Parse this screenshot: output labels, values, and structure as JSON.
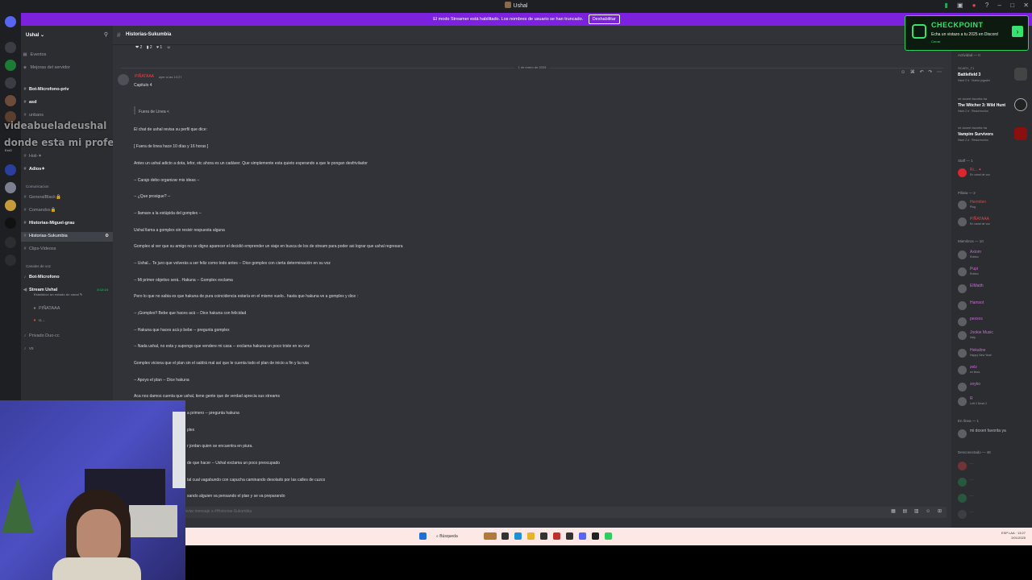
{
  "window": {
    "title": "Ushal"
  },
  "streamer_bar": {
    "text": "El modo Streamer está habilitado. Los nombres de usuario se han truncado.",
    "button": "Deshabilitar"
  },
  "sidebar": {
    "server_name": "Ushal",
    "items": [
      {
        "type": "link",
        "label": "Eventos",
        "icon": "calendar-icon"
      },
      {
        "type": "link",
        "label": "Mejoras del servidor",
        "icon": "boost-icon"
      },
      {
        "type": "channel",
        "label": "Bot-Microfono-priv",
        "bold": true
      },
      {
        "type": "channel",
        "label": "asd",
        "bold": true
      },
      {
        "type": "channel",
        "label": "unbans"
      },
      {
        "type": "channel",
        "label": "Holi-✦"
      },
      {
        "type": "channel",
        "label": "Adios✦",
        "bold": true
      },
      {
        "type": "category",
        "label": "Comunicacion"
      },
      {
        "type": "channel",
        "label": "GeneralBlack🔒"
      },
      {
        "type": "channel",
        "label": "Comandos🔒"
      },
      {
        "type": "channel",
        "label": "Historias-Miguel-grau",
        "bold": true
      },
      {
        "type": "channel",
        "label": "Historias-Sukumbia",
        "active": true
      },
      {
        "type": "channel",
        "label": "Clips-Videoss"
      },
      {
        "type": "category",
        "label": "Canales de voz"
      },
      {
        "type": "channel",
        "label": "Bot-Microfono",
        "bold": true
      },
      {
        "type": "voice",
        "label": "Stream Ushal",
        "bold": true,
        "live": "3:12:24",
        "sub": "Establece un estado de canal ✎"
      },
      {
        "type": "user",
        "label": "PIÑATAAA"
      },
      {
        "type": "user",
        "label": "u..."
      },
      {
        "type": "channel",
        "label": "Privado Duo-cc"
      },
      {
        "type": "channel",
        "label": "vs"
      }
    ],
    "overlay_line1": "videabueladeushal",
    "overlay_line2": "donde esta mi profe.hakuna",
    "rail_label": "EstG"
  },
  "channel_header": {
    "name": "Historias-Sukumbia"
  },
  "reactions": [
    "❤ 2",
    "▮ 2",
    "♥ 1",
    "☺"
  ],
  "date_divider": "1 de enero de 2025",
  "message": {
    "author": "PIÑATAAA",
    "time": "ayer a las 13:27",
    "lines": [
      "Capitulo 4",
      "Fuera de Linea <",
      "El chat de ushal revisa su perfil que dice:",
      "[ Fuera de linea hace 10 días y 16 horas ]",
      "Antes un ushal adicto a dota, lefor, etc ahora es un cadáver. Que simplemente esta quieto esperando a que le pongan desfrivilador",
      "-- Carajo debo organizar mis ideas --",
      "-- ¿Que prosigue? --",
      "-- llamare a la estúpida del gomplex --",
      "Ushal llama a gomplex sin resivir respuesta alguna",
      "Gomplex al ver que su amigo no se digno aparecer el decidió emprender un viaje en busca de los de stream para poder asi lograr que ushal regresara",
      "-- Ushal... Te juro que volverás a ser feliz como todo antes --   Dice gomplex con cierta determinación en su voz",
      "-- Mi primer objetivo será.. Hakuna -- Gomplex exclama",
      "Pero lo que no sabia es que hakuna de pura coincidencia estaría en el mismo vuelo.. hasta que hakuna ve a gomplex y dice :",
      "-- ¡Gomplex!! Bebe que haces acá -- Dice hakuna con felicidad",
      "-- Hakuna que haces acá p bebe -- pregunta gomplex",
      "-- Nada ushal, no esta y supongo que vendere mi casa -- exclama hakuna un poco triste en su voz",
      "Gomplex viciona que el plan sin el saldrá mal así que le cuenta todo el plan de inicio a fin y la ruta",
      "-- Apoyo el plan -- Dice hakuna",
      "Aca nos damos cuenta que ushal, tiene gente que de verdad aprecia sus streams",
      "a primero -- pregunta hakuna",
      "plex",
      "r jordan quien se encuentra en piura.",
      "de que hacer -- Ushal exclama un poco preocupado",
      "tal cual vagabundo con capucha caminando desolado por las calles de cuzco",
      "sando alguien va pensando el plan y se va preparando"
    ]
  },
  "input": {
    "placeholder": "Enviar mensaje a #Historias-Sukumbia"
  },
  "members": {
    "activity_label": "Actividad — 0",
    "activities": [
      {
        "line1": "SCAR1_T1",
        "line2": "Battlefield 3",
        "line3": "Hace 2 d · Nuevo jugador"
      },
      {
        "line1": "mi doxeri favorita ha",
        "line2": "The Witcher 3: Wild Hunt",
        "line3": "Hace 2 d · Resurrección"
      },
      {
        "line1": "mi doxeri favorita ha",
        "line2": "Vampire Survivors",
        "line3": "Hace 2 d · Resurrección"
      }
    ],
    "groups": [
      {
        "label": "Staff — 1",
        "members": [
          {
            "name": "Ri... ✦",
            "status": "En canal de voz",
            "color": "#f23f43"
          }
        ]
      },
      {
        "label": "Pillata — 2",
        "members": [
          {
            "name": "Hermilen",
            "status": "Plug",
            "color": "#f23f43"
          },
          {
            "name": "PIÑATAAA",
            "status": "En canal de voz",
            "color": "#f23f43"
          }
        ]
      },
      {
        "label": "Miembros — 10",
        "members": [
          {
            "name": "Axiom",
            "status": "Roblox",
            "color": "#c96bd6"
          },
          {
            "name": "Pupi",
            "status": "Roblox",
            "color": "#c96bd6"
          },
          {
            "name": "ElMatih",
            "status": "",
            "color": "#c96bd6"
          },
          {
            "name": "Hamsot",
            "status": "",
            "color": "#c96bd6"
          },
          {
            "name": "pexxos",
            "status": "",
            "color": "#c96bd6"
          },
          {
            "name": "Jookie Music",
            "status": "Help",
            "color": "#c96bd6"
          },
          {
            "name": "Hekaline",
            "status": "Happy New Year!",
            "color": "#c96bd6"
          },
          {
            "name": "zelz",
            "status": "en linea",
            "color": "#c96bd6"
          },
          {
            "name": "zeyko",
            "status": "",
            "color": "#c96bd6"
          },
          {
            "name": "R",
            "status": "Left 4 Dead 2",
            "color": "#c96bd6"
          }
        ]
      },
      {
        "label": "En línea — 1",
        "members": [
          {
            "name": "mi doxeri favorita ya",
            "status": "",
            "color": "#b5bac1"
          }
        ]
      },
      {
        "label": "Desconectado — 48",
        "members": [
          {
            "name": "...",
            "status": "",
            "color": "#b5bac1"
          },
          {
            "name": "...",
            "status": "",
            "color": "#b5bac1"
          },
          {
            "name": "...",
            "status": "",
            "color": "#b5bac1"
          },
          {
            "name": "...",
            "status": "",
            "color": "#b5bac1"
          }
        ]
      }
    ]
  },
  "checkpoint": {
    "title": "CHECKPOINT",
    "subtitle": "Echa un vistazo a tu 2025 en Discord",
    "close": "Cerrar"
  },
  "taskbar": {
    "search": "Búsqueda",
    "tray_time": "13:27",
    "tray_date": "2/01/2025",
    "tray_lang": "ESP LAA"
  },
  "colors": {
    "accent": "#5865f2",
    "streamer_bar": "#7c22df",
    "checkpoint_green": "#35e36f",
    "author_red": "#f23f43"
  }
}
